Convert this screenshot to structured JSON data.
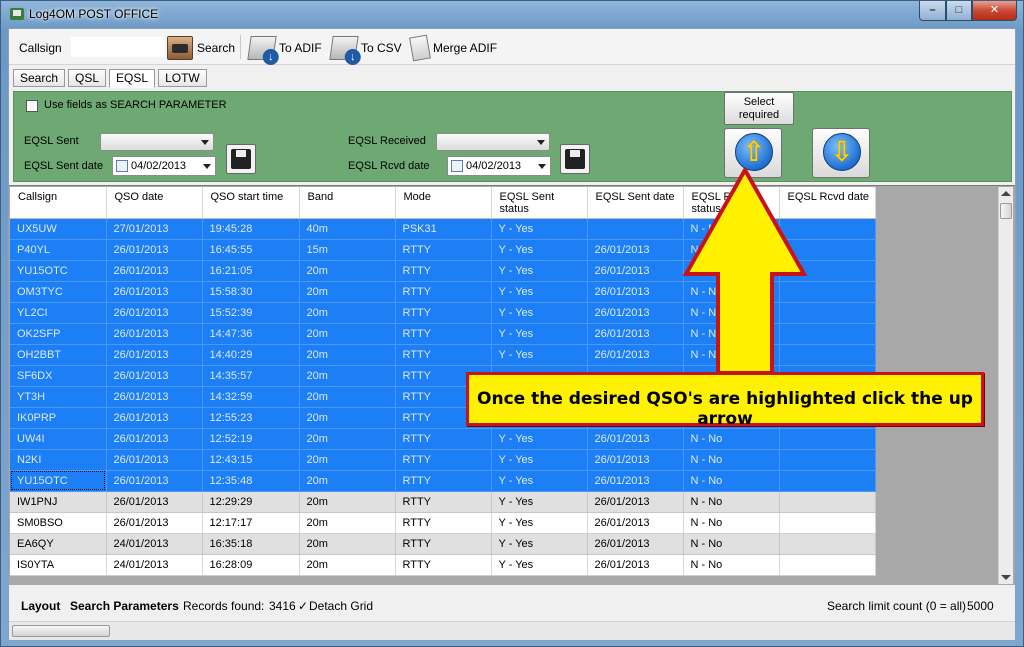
{
  "window": {
    "title": "Log4OM POST OFFICE"
  },
  "toolbar": {
    "callsign_label": "Callsign",
    "callsign_value": "",
    "search": "Search",
    "to_adif": "To ADIF",
    "to_csv": "To CSV",
    "merge_adif": "Merge ADIF"
  },
  "tabs": [
    {
      "label": "Search"
    },
    {
      "label": "QSL"
    },
    {
      "label": "EQSL",
      "active": true
    },
    {
      "label": "LOTW"
    }
  ],
  "panel": {
    "use_fields": "Use fields as SEARCH PARAMETER",
    "eqsl_sent_label": "EQSL Sent",
    "eqsl_sent_date_label": "EQSL Sent date",
    "eqsl_sent_date": "04/02/2013",
    "eqsl_received_label": "EQSL Received",
    "eqsl_rcvd_date_label": "EQSL Rcvd date",
    "eqsl_rcvd_date": "04/02/2013",
    "select_required": "Select required"
  },
  "grid": {
    "columns": [
      "Callsign",
      "QSO date",
      "QSO start time",
      "Band",
      "Mode",
      "EQSL Sent status",
      "EQSL Sent date",
      "EQSL Rcvd status",
      "EQSL Rcvd date"
    ],
    "rows": [
      {
        "sel": true,
        "c": [
          "UX5UW",
          "27/01/2013",
          "19:45:28",
          "40m",
          "PSK31",
          "Y - Yes",
          "",
          "N - No",
          ""
        ]
      },
      {
        "sel": true,
        "c": [
          "P40YL",
          "26/01/2013",
          "16:45:55",
          "15m",
          "RTTY",
          "Y - Yes",
          "26/01/2013",
          "N - No",
          ""
        ]
      },
      {
        "sel": true,
        "c": [
          "YU15OTC",
          "26/01/2013",
          "16:21:05",
          "20m",
          "RTTY",
          "Y - Yes",
          "26/01/2013",
          "N - No",
          ""
        ]
      },
      {
        "sel": true,
        "c": [
          "OM3TYC",
          "26/01/2013",
          "15:58:30",
          "20m",
          "RTTY",
          "Y - Yes",
          "26/01/2013",
          "N - No",
          ""
        ]
      },
      {
        "sel": true,
        "c": [
          "YL2CI",
          "26/01/2013",
          "15:52:39",
          "20m",
          "RTTY",
          "Y - Yes",
          "26/01/2013",
          "N - No",
          ""
        ]
      },
      {
        "sel": true,
        "c": [
          "OK2SFP",
          "26/01/2013",
          "14:47:36",
          "20m",
          "RTTY",
          "Y - Yes",
          "26/01/2013",
          "N - No",
          ""
        ]
      },
      {
        "sel": true,
        "c": [
          "OH2BBT",
          "26/01/2013",
          "14:40:29",
          "20m",
          "RTTY",
          "Y - Yes",
          "26/01/2013",
          "N - No",
          ""
        ]
      },
      {
        "sel": true,
        "c": [
          "SF6DX",
          "26/01/2013",
          "14:35:57",
          "20m",
          "RTTY",
          "",
          "",
          "",
          ""
        ]
      },
      {
        "sel": true,
        "c": [
          "YT3H",
          "26/01/2013",
          "14:32:59",
          "20m",
          "RTTY",
          "",
          "",
          "",
          ""
        ]
      },
      {
        "sel": true,
        "c": [
          "IK0PRP",
          "26/01/2013",
          "12:55:23",
          "20m",
          "RTTY",
          "",
          "",
          "",
          ""
        ]
      },
      {
        "sel": true,
        "c": [
          "UW4I",
          "26/01/2013",
          "12:52:19",
          "20m",
          "RTTY",
          "Y - Yes",
          "26/01/2013",
          "N - No",
          ""
        ]
      },
      {
        "sel": true,
        "c": [
          "N2KI",
          "26/01/2013",
          "12:43:15",
          "20m",
          "RTTY",
          "Y - Yes",
          "26/01/2013",
          "N - No",
          ""
        ]
      },
      {
        "sel": true,
        "focus": true,
        "c": [
          "YU15OTC",
          "26/01/2013",
          "12:35:48",
          "20m",
          "RTTY",
          "Y - Yes",
          "26/01/2013",
          "N - No",
          ""
        ]
      },
      {
        "sel": false,
        "c": [
          "IW1PNJ",
          "26/01/2013",
          "12:29:29",
          "20m",
          "RTTY",
          "Y - Yes",
          "26/01/2013",
          "N - No",
          ""
        ]
      },
      {
        "sel": false,
        "c": [
          "SM0BSO",
          "26/01/2013",
          "12:17:17",
          "20m",
          "RTTY",
          "Y - Yes",
          "26/01/2013",
          "N - No",
          ""
        ]
      },
      {
        "sel": false,
        "c": [
          "EA6QY",
          "24/01/2013",
          "16:35:18",
          "20m",
          "RTTY",
          "Y - Yes",
          "26/01/2013",
          "N - No",
          ""
        ]
      },
      {
        "sel": false,
        "c": [
          "IS0YTA",
          "24/01/2013",
          "16:28:09",
          "20m",
          "RTTY",
          "Y - Yes",
          "26/01/2013",
          "N - No",
          ""
        ]
      }
    ]
  },
  "status": {
    "layout": "Layout",
    "search_parameters": "Search Parameters",
    "records_found_label": "Records found:",
    "records_found": "3416",
    "detach_grid": "Detach Grid",
    "search_limit_label": "Search limit count (0 = all)",
    "search_limit": "5000"
  },
  "annotation": {
    "text": "Once the desired QSO's are highlighted click the up arrow"
  },
  "colors": {
    "panel_green": "#6ea872",
    "selected_row": "#1d7ff5",
    "callout_fill": "#fff100",
    "callout_border": "#c8121a"
  }
}
